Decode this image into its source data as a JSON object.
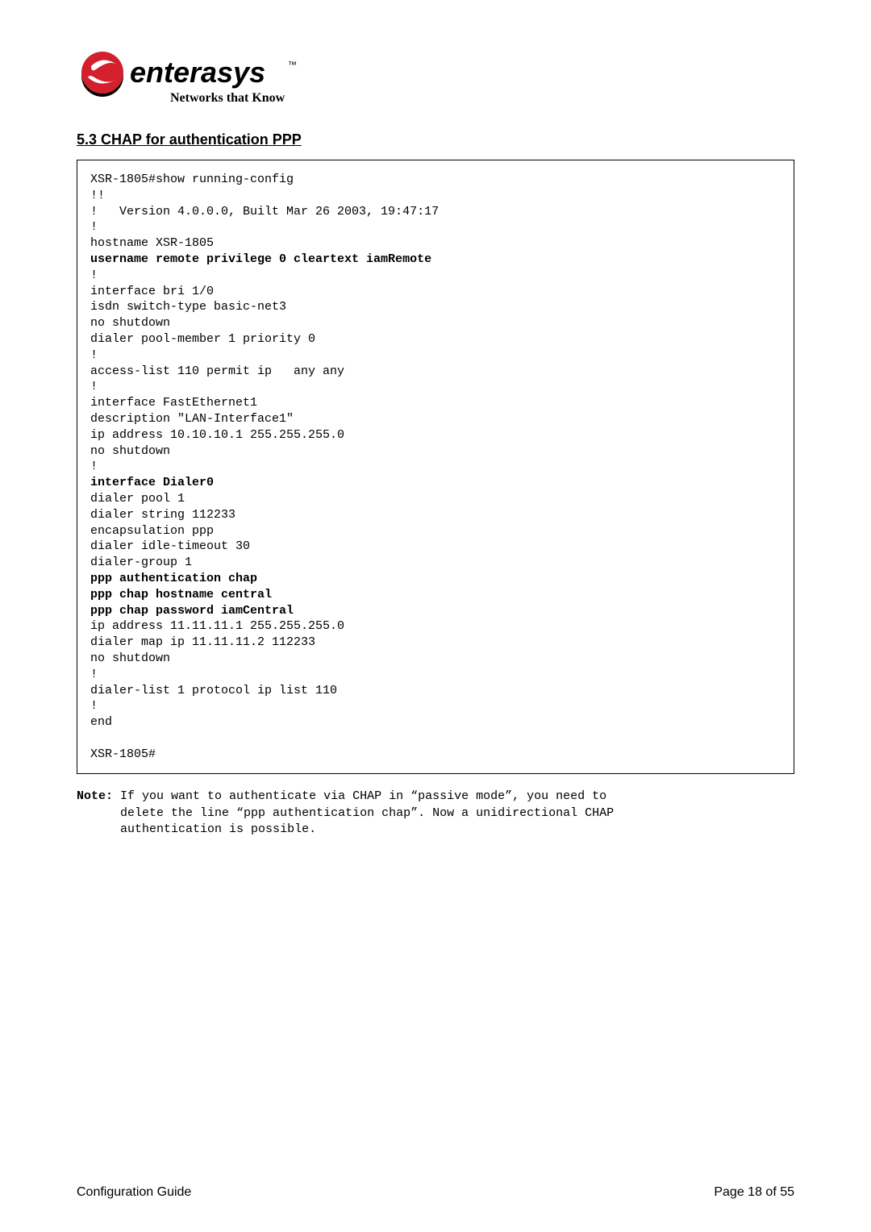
{
  "logo": {
    "brand": "enterasys",
    "tm": "™",
    "tagline": "Networks that Know"
  },
  "section": {
    "number": "5.3",
    "title": "CHAP for authentication PPP"
  },
  "code": {
    "lines": [
      {
        "t": "XSR-1805#show running-config",
        "b": false
      },
      {
        "t": "!!",
        "b": false
      },
      {
        "t": "!   Version 4.0.0.0, Built Mar 26 2003, 19:47:17",
        "b": false
      },
      {
        "t": "!",
        "b": false
      },
      {
        "t": "hostname XSR-1805",
        "b": false
      },
      {
        "t": "username remote privilege 0 cleartext iamRemote",
        "b": true
      },
      {
        "t": "!",
        "b": false
      },
      {
        "t": "interface bri 1/0",
        "b": false
      },
      {
        "t": "isdn switch-type basic-net3",
        "b": false
      },
      {
        "t": "no shutdown",
        "b": false
      },
      {
        "t": "dialer pool-member 1 priority 0",
        "b": false
      },
      {
        "t": "!",
        "b": false
      },
      {
        "t": "access-list 110 permit ip   any any",
        "b": false
      },
      {
        "t": "!",
        "b": false
      },
      {
        "t": "interface FastEthernet1",
        "b": false
      },
      {
        "t": "description \"LAN-Interface1\"",
        "b": false
      },
      {
        "t": "ip address 10.10.10.1 255.255.255.0",
        "b": false
      },
      {
        "t": "no shutdown",
        "b": false
      },
      {
        "t": "!",
        "b": false
      },
      {
        "t": "interface Dialer0",
        "b": true
      },
      {
        "t": "dialer pool 1",
        "b": false
      },
      {
        "t": "dialer string 112233",
        "b": false
      },
      {
        "t": "encapsulation ppp",
        "b": false
      },
      {
        "t": "dialer idle-timeout 30",
        "b": false
      },
      {
        "t": "dialer-group 1",
        "b": false
      },
      {
        "t": "ppp authentication chap",
        "b": true
      },
      {
        "t": "ppp chap hostname central",
        "b": true
      },
      {
        "t": "ppp chap password iamCentral",
        "b": true
      },
      {
        "t": "ip address 11.11.11.1 255.255.255.0",
        "b": false
      },
      {
        "t": "dialer map ip 11.11.11.2 112233",
        "b": false
      },
      {
        "t": "no shutdown",
        "b": false
      },
      {
        "t": "!",
        "b": false
      },
      {
        "t": "dialer-list 1 protocol ip list 110",
        "b": false
      },
      {
        "t": "!",
        "b": false
      },
      {
        "t": "end",
        "b": false
      },
      {
        "t": " ",
        "b": false
      },
      {
        "t": "XSR-1805#",
        "b": false
      }
    ]
  },
  "note": {
    "label": "Note:",
    "body_line1": "If you want to authenticate via CHAP in “passive mode”, you need to",
    "body_line2": "delete the line “ppp authentication chap”. Now a unidirectional CHAP",
    "body_line3": "authentication is possible."
  },
  "footer": {
    "left": "Configuration Guide",
    "right": "Page 18 of 55"
  }
}
